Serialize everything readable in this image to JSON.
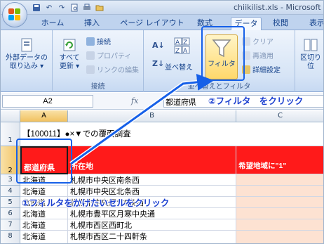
{
  "window": {
    "title": "chiikilist.xls - Microsoft"
  },
  "tabs": [
    "ホーム",
    "挿入",
    "ページ レイアウト",
    "数式",
    "データ",
    "校閲",
    "表示"
  ],
  "active_tab": "データ",
  "ribbon": {
    "external_data": {
      "label": "外部データの取り込み",
      "line1": "外部データの",
      "line2": "取り込み ▾"
    },
    "connections": {
      "refresh_all_line1": "すべて",
      "refresh_all_line2": "更新 ▾",
      "connect": "接続",
      "properties": "プロパティ",
      "edit_links": "リンクの編集",
      "group_label": "接続"
    },
    "sort_filter": {
      "sort": "並べ替え",
      "filter": "フィルタ",
      "clear": "クリア",
      "reapply": "再適用",
      "advanced": "詳細設定",
      "group_label": "並べ替えとフィルタ"
    },
    "data_tools": {
      "text_to_columns": "区切り位"
    }
  },
  "formula_bar": {
    "name_box": "A2",
    "fx": "fx",
    "formula": "都道府県"
  },
  "grid": {
    "columns": [
      "A",
      "B",
      "C"
    ],
    "rows": [
      {
        "num": "1",
        "a": "【100011】●×▼での覆面調査",
        "b": "",
        "c": ""
      },
      {
        "num": "2",
        "a": "都道府県",
        "b": "所在地",
        "c": "希望地域に\"1\""
      },
      {
        "num": "3",
        "a": "北海道",
        "b": "札幌市中央区南条西",
        "c": ""
      },
      {
        "num": "4",
        "a": "北海道",
        "b": "札幌市中央区北条西",
        "c": ""
      },
      {
        "num": "5",
        "a": "北海道",
        "b": "札幌市中央区北5条西",
        "c": ""
      },
      {
        "num": "6",
        "a": "北海道",
        "b": "札幌市豊平区月寒中央通",
        "c": ""
      },
      {
        "num": "7",
        "a": "北海道",
        "b": "札幌市西区西町北",
        "c": ""
      },
      {
        "num": "8",
        "a": "北海道",
        "b": "札幌市西区二十四軒条",
        "c": ""
      }
    ]
  },
  "annotations": {
    "step1": "①フィルタをかけたいセルをクリック",
    "step2": "②フィルタ　をクリック"
  },
  "colors": {
    "accent": "#1660e8",
    "header_red": "#ff1a1a",
    "peach": "#fde2d2"
  }
}
